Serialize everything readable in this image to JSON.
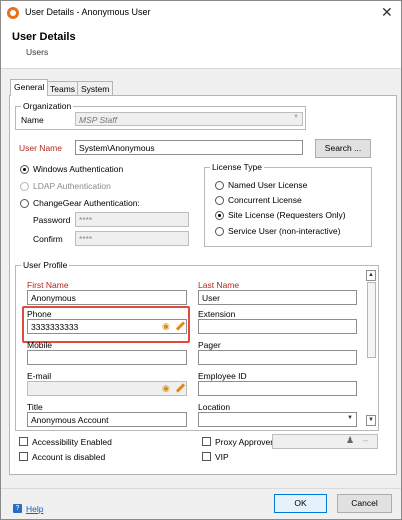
{
  "window": {
    "title": "User Details - Anonymous User",
    "close": "✕"
  },
  "header": {
    "title": "User Details",
    "subtitle": "Users"
  },
  "tabs": [
    {
      "label": "General",
      "active": true
    },
    {
      "label": "Teams",
      "active": false
    },
    {
      "label": "System",
      "active": false
    }
  ],
  "organization": {
    "legend": "Organization",
    "name_label": "Name",
    "name_value": "MSP Staff"
  },
  "username": {
    "label": "User Name",
    "value": "System\\Anonymous",
    "search_button": "Search ..."
  },
  "auth": {
    "windows": "Windows Authentication",
    "ldap": "LDAP Authentication",
    "changegear": "ChangeGear Authentication:",
    "password_label": "Password",
    "password_value": "****",
    "confirm_label": "Confirm",
    "confirm_value": "****"
  },
  "license": {
    "legend": "License Type",
    "options": [
      "Named User License",
      "Concurrent License",
      "Site License (Requesters Only)",
      "Service User (non-interactive)"
    ],
    "selected": "Site License (Requesters Only)"
  },
  "profile": {
    "legend": "User Profile",
    "first_name_label": "First Name",
    "first_name": "Anonymous",
    "last_name_label": "Last Name",
    "last_name": "User",
    "phone_label": "Phone",
    "phone": "3333333333",
    "extension_label": "Extension",
    "extension": "",
    "mobile_label": "Mobile",
    "mobile": "",
    "pager_label": "Pager",
    "pager": "",
    "email_label": "E-mail",
    "email": "",
    "employee_id_label": "Employee ID",
    "employee_id": "",
    "title_label": "Title",
    "title": "Anonymous Account",
    "location_label": "Location",
    "location": ""
  },
  "options": {
    "accessibility": "Accessibility Enabled",
    "disabled": "Account is disabled",
    "proxy_approver": "Proxy Approver",
    "vip": "VIP"
  },
  "footer": {
    "help": "Help",
    "ok": "OK",
    "cancel": "Cancel"
  },
  "colors": {
    "required_label": "#b3261e",
    "highlight": "#e04a3f",
    "edit_icon": "#e08a14",
    "app_icon": "#e8701a"
  }
}
